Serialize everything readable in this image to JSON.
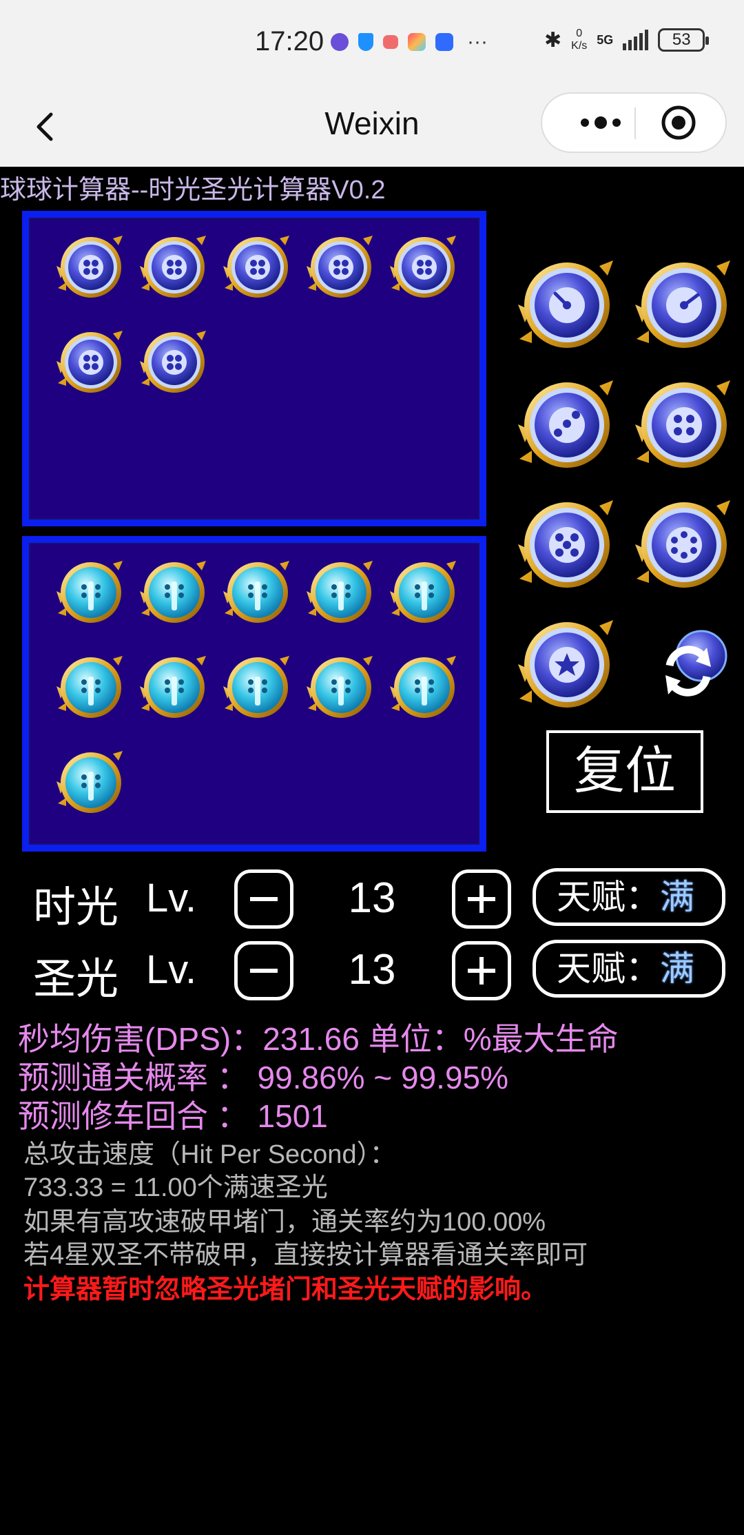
{
  "status_bar": {
    "time": "17:20",
    "speed_value": "0",
    "speed_unit": "K/s",
    "network": "5G",
    "battery": "53",
    "more": "···"
  },
  "header": {
    "title": "Weixin"
  },
  "app": {
    "title": "球球计算器--时光圣光计算器V0.2",
    "top_grid_count": 7,
    "bottom_grid_count": 11,
    "reset_label": "复位",
    "rows": [
      {
        "name": "时光",
        "lv": "Lv.",
        "value": "13",
        "talent_label": "天赋：",
        "talent_value": "满"
      },
      {
        "name": "圣光",
        "lv": "Lv.",
        "value": "13",
        "talent_label": "天赋：",
        "talent_value": "满"
      }
    ],
    "dps_line": "秒均伤害(DPS)：231.66   单位：%最大生命",
    "clear_prob_line": "预测通关概率  ：  99.86% ~ 99.95%",
    "repair_round_line": "预测修车回合  ：  1501",
    "attack_speed_line": "总攻击速度（Hit Per Second）：",
    "speed_calc_line": "733.33 = 11.00个满速圣光",
    "note1": "如果有高攻速破甲堵门，通关率约为100.00%",
    "note2": "若4星双圣不带破甲，直接按计算器看通关率即可",
    "warning": "计算器暂时忽略圣光堵门和圣光天赋的影响。"
  }
}
